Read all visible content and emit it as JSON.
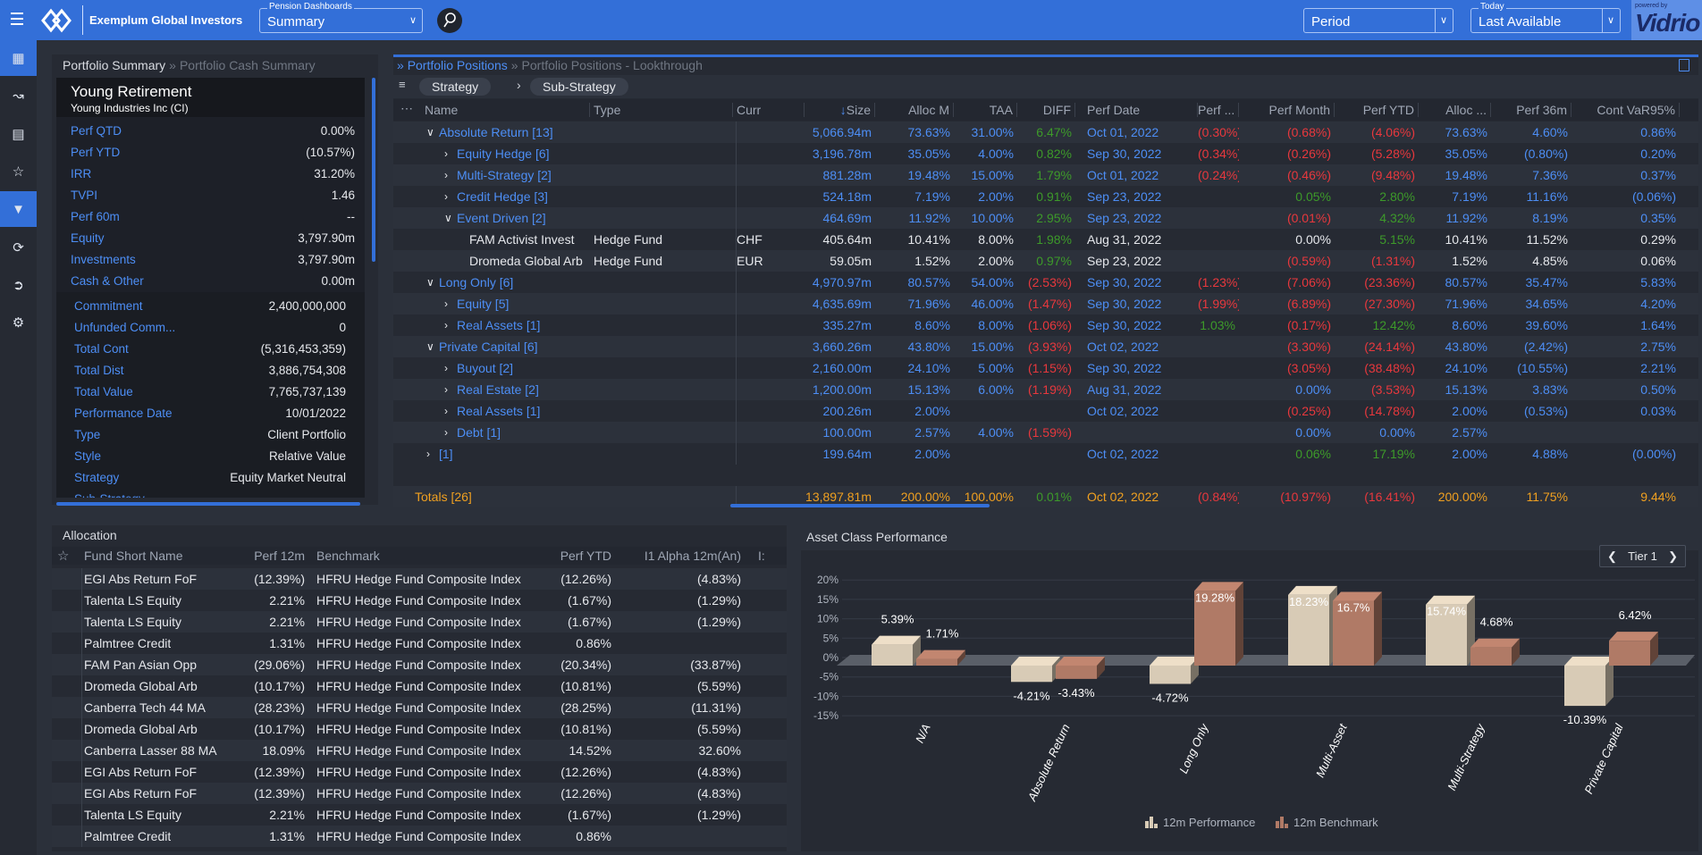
{
  "header": {
    "brand": "Exemplum Global Investors",
    "dashboard_label": "Pension Dashboards",
    "dashboard_value": "Summary",
    "period_value": "Period",
    "today_label": "Today",
    "today_value": "Last Available",
    "powered_by": "powered by",
    "vendor_logo": "Vidrio"
  },
  "sidebar": {
    "items": [
      {
        "icon": "grid-icon",
        "active": true
      },
      {
        "icon": "line-chart-icon",
        "active": false
      },
      {
        "icon": "id-card-icon",
        "active": false
      },
      {
        "icon": "star-icon",
        "active": false
      },
      {
        "icon": "filter-icon",
        "active": true
      },
      {
        "icon": "refresh-icon",
        "active": false
      },
      {
        "icon": "export-icon",
        "active": false
      },
      {
        "icon": "gear-icon",
        "active": false
      }
    ]
  },
  "summary": {
    "tab_active": "Portfolio Summary",
    "tab_inactive": "Portfolio Cash Summary",
    "title": "Young Retirement",
    "subtitle": "Young Industries Inc (CI)",
    "group1": [
      {
        "k": "Perf QTD",
        "v": "0.00%"
      },
      {
        "k": "Perf YTD",
        "v": "(10.57%)"
      },
      {
        "k": "IRR",
        "v": "31.20%"
      },
      {
        "k": "TVPI",
        "v": "1.46"
      },
      {
        "k": "Perf 60m",
        "v": "--"
      },
      {
        "k": "Equity",
        "v": "3,797.90m"
      },
      {
        "k": "Investments",
        "v": "3,797.90m"
      },
      {
        "k": "Cash & Other",
        "v": "0.00m"
      }
    ],
    "group2": [
      {
        "k": "Commitment",
        "v": "2,400,000,000"
      },
      {
        "k": "Unfunded Comm...",
        "v": "0"
      },
      {
        "k": "Total Cont",
        "v": "(5,316,453,359)"
      },
      {
        "k": "Total Dist",
        "v": "3,886,754,308"
      },
      {
        "k": "Total Value",
        "v": "7,765,737,139"
      },
      {
        "k": "Performance Date",
        "v": "10/01/2022"
      },
      {
        "k": "Type",
        "v": "Client Portfolio"
      },
      {
        "k": "Style",
        "v": "Relative Value"
      },
      {
        "k": "Strategy",
        "v": "Equity Market Neutral"
      },
      {
        "k": "Sub-Strategy",
        "v": "--"
      }
    ]
  },
  "positions": {
    "tab_active": "Portfolio Positions",
    "tab_inactive": "Portfolio Positions - Lookthrough",
    "groupings": [
      "Strategy",
      "Sub-Strategy"
    ],
    "sort_indicator": "↓",
    "columns": [
      "Name",
      "Type",
      "Curr",
      "Size",
      "Alloc M",
      "TAA",
      "DIFF",
      "Perf Date",
      "Perf ...",
      "Perf Month",
      "Perf YTD",
      "Alloc ...",
      "Perf 36m",
      "Cont VaR95%"
    ],
    "rows": [
      {
        "level": 0,
        "toggle": "down",
        "kind": "group",
        "name": "Absolute Return [13]",
        "type": "",
        "curr": "",
        "cells": [
          "5,066.94m",
          "73.63%",
          "31.00%",
          "6.47%",
          "Oct 01, 2022",
          "(0.30%)",
          "(0.68%)",
          "(4.06%)",
          "73.63%",
          "4.60%",
          "0.86%"
        ]
      },
      {
        "level": 1,
        "toggle": "right",
        "kind": "group",
        "name": "Equity Hedge [6]",
        "type": "",
        "curr": "",
        "cells": [
          "3,196.78m",
          "35.05%",
          "4.00%",
          "0.82%",
          "Sep 30, 2022",
          "(0.34%)",
          "(0.26%)",
          "(5.28%)",
          "35.05%",
          "(0.80%)",
          "0.20%"
        ]
      },
      {
        "level": 1,
        "toggle": "right",
        "kind": "group",
        "name": "Multi-Strategy [2]",
        "type": "",
        "curr": "",
        "cells": [
          "881.28m",
          "19.48%",
          "15.00%",
          "1.79%",
          "Oct 01, 2022",
          "(0.24%)",
          "(0.46%)",
          "(9.48%)",
          "19.48%",
          "7.36%",
          "0.37%"
        ]
      },
      {
        "level": 1,
        "toggle": "right",
        "kind": "group",
        "name": "Credit Hedge [3]",
        "type": "",
        "curr": "",
        "cells": [
          "524.18m",
          "7.19%",
          "2.00%",
          "0.91%",
          "Sep 23, 2022",
          "",
          "0.05%",
          "2.80%",
          "7.19%",
          "11.16%",
          "(0.06%)"
        ]
      },
      {
        "level": 1,
        "toggle": "down",
        "kind": "group",
        "name": "Event Driven [2]",
        "type": "",
        "curr": "",
        "cells": [
          "464.69m",
          "11.92%",
          "10.00%",
          "2.95%",
          "Sep 23, 2022",
          "",
          "(0.01%)",
          "4.32%",
          "11.92%",
          "8.19%",
          "0.35%"
        ]
      },
      {
        "level": 2,
        "toggle": "",
        "kind": "leaf",
        "name": "FAM Activist Invest",
        "type": "Hedge Fund",
        "curr": "CHF",
        "cells": [
          "405.64m",
          "10.41%",
          "8.00%",
          "1.98%",
          "Aug 31, 2022",
          "",
          "0.00%",
          "5.15%",
          "10.41%",
          "11.52%",
          "0.29%"
        ]
      },
      {
        "level": 2,
        "toggle": "",
        "kind": "leaf",
        "name": "Dromeda Global Arb",
        "type": "Hedge Fund",
        "curr": "EUR",
        "cells": [
          "59.05m",
          "1.52%",
          "2.00%",
          "0.97%",
          "Sep 23, 2022",
          "",
          "(0.59%)",
          "(1.31%)",
          "1.52%",
          "4.85%",
          "0.06%"
        ]
      },
      {
        "level": 0,
        "toggle": "down",
        "kind": "group",
        "name": "Long Only [6]",
        "type": "",
        "curr": "",
        "cells": [
          "4,970.97m",
          "80.57%",
          "54.00%",
          "(2.53%)",
          "Sep 30, 2022",
          "(1.23%)",
          "(7.06%)",
          "(23.36%)",
          "80.57%",
          "35.47%",
          "5.83%"
        ]
      },
      {
        "level": 1,
        "toggle": "right",
        "kind": "group",
        "name": "Equity [5]",
        "type": "",
        "curr": "",
        "cells": [
          "4,635.69m",
          "71.96%",
          "46.00%",
          "(1.47%)",
          "Sep 30, 2022",
          "(1.99%)",
          "(6.89%)",
          "(27.30%)",
          "71.96%",
          "34.65%",
          "4.20%"
        ]
      },
      {
        "level": 1,
        "toggle": "right",
        "kind": "group",
        "name": "Real Assets [1]",
        "type": "",
        "curr": "",
        "cells": [
          "335.27m",
          "8.60%",
          "8.00%",
          "(1.06%)",
          "Sep 30, 2022",
          "1.03%",
          "(0.17%)",
          "12.42%",
          "8.60%",
          "39.60%",
          "1.64%"
        ]
      },
      {
        "level": 0,
        "toggle": "down",
        "kind": "group",
        "name": "Private Capital [6]",
        "type": "",
        "curr": "",
        "cells": [
          "3,660.26m",
          "43.80%",
          "15.00%",
          "(3.93%)",
          "Oct 02, 2022",
          "",
          "(3.30%)",
          "(24.14%)",
          "43.80%",
          "(2.42%)",
          "2.75%"
        ]
      },
      {
        "level": 1,
        "toggle": "right",
        "kind": "group",
        "name": "Buyout [2]",
        "type": "",
        "curr": "",
        "cells": [
          "2,160.00m",
          "24.10%",
          "5.00%",
          "(1.15%)",
          "Sep 30, 2022",
          "",
          "(3.05%)",
          "(38.48%)",
          "24.10%",
          "(10.55%)",
          "2.21%"
        ]
      },
      {
        "level": 1,
        "toggle": "right",
        "kind": "group",
        "name": "Real Estate [2]",
        "type": "",
        "curr": "",
        "cells": [
          "1,200.00m",
          "15.13%",
          "6.00%",
          "(1.19%)",
          "Aug 31, 2022",
          "",
          "0.00%",
          "(3.53%)",
          "15.13%",
          "3.83%",
          "0.50%"
        ]
      },
      {
        "level": 1,
        "toggle": "right",
        "kind": "group",
        "name": "Real Assets [1]",
        "type": "",
        "curr": "",
        "cells": [
          "200.26m",
          "2.00%",
          "",
          "",
          "Oct 02, 2022",
          "",
          "(0.25%)",
          "(14.78%)",
          "2.00%",
          "(0.53%)",
          "0.03%"
        ]
      },
      {
        "level": 1,
        "toggle": "right",
        "kind": "group",
        "name": "Debt [1]",
        "type": "",
        "curr": "",
        "cells": [
          "100.00m",
          "2.57%",
          "4.00%",
          "(1.59%)",
          "",
          "",
          "0.00%",
          "0.00%",
          "2.57%",
          "",
          ""
        ]
      },
      {
        "level": 0,
        "toggle": "right",
        "kind": "group",
        "name": "[1]",
        "type": "",
        "curr": "",
        "cells": [
          "199.64m",
          "2.00%",
          "",
          "",
          "Oct 02, 2022",
          "",
          "0.06%",
          "17.19%",
          "2.00%",
          "4.88%",
          "(0.00%)"
        ]
      }
    ],
    "totals": {
      "name": "Totals [26]",
      "cells": [
        "13,897.81m",
        "200.00%",
        "100.00%",
        "0.01%",
        "Oct 02, 2022",
        "(0.84%)",
        "(10.97%)",
        "(16.41%)",
        "200.00%",
        "11.75%",
        "9.44%"
      ]
    }
  },
  "allocation": {
    "title": "Allocation",
    "columns": [
      "Fund Short Name",
      "Perf 12m",
      "Benchmark",
      "Perf YTD",
      "I1 Alpha 12m(An)",
      "I:"
    ],
    "rows": [
      [
        "EGI Abs Return FoF",
        "(12.39%)",
        "HFRU Hedge Fund Composite Index",
        "(12.26%)",
        "(4.83%)"
      ],
      [
        "Talenta LS Equity",
        "2.21%",
        "HFRU Hedge Fund Composite Index",
        "(1.67%)",
        "(1.29%)"
      ],
      [
        "Talenta LS Equity",
        "2.21%",
        "HFRU Hedge Fund Composite Index",
        "(1.67%)",
        "(1.29%)"
      ],
      [
        "Palmtree Credit",
        "1.31%",
        "HFRU Hedge Fund Composite Index",
        "0.86%",
        ""
      ],
      [
        "FAM Pan Asian Opp",
        "(29.06%)",
        "HFRU Hedge Fund Composite Index",
        "(20.34%)",
        "(33.87%)"
      ],
      [
        "Dromeda Global Arb",
        "(10.17%)",
        "HFRU Hedge Fund Composite Index",
        "(10.81%)",
        "(5.59%)"
      ],
      [
        "Canberra Tech 44 MA",
        "(28.23%)",
        "HFRU Hedge Fund Composite Index",
        "(28.25%)",
        "(11.31%)"
      ],
      [
        "Dromeda Global Arb",
        "(10.17%)",
        "HFRU Hedge Fund Composite Index",
        "(10.81%)",
        "(5.59%)"
      ],
      [
        "Canberra Lasser 88 MA",
        "18.09%",
        "HFRU Hedge Fund Composite Index",
        "14.52%",
        "32.60%"
      ],
      [
        "EGI Abs Return FoF",
        "(12.39%)",
        "HFRU Hedge Fund Composite Index",
        "(12.26%)",
        "(4.83%)"
      ],
      [
        "EGI Abs Return FoF",
        "(12.39%)",
        "HFRU Hedge Fund Composite Index",
        "(12.26%)",
        "(4.83%)"
      ],
      [
        "Talenta LS Equity",
        "2.21%",
        "HFRU Hedge Fund Composite Index",
        "(1.67%)",
        "(1.29%)"
      ],
      [
        "Palmtree Credit",
        "1.31%",
        "HFRU Hedge Fund Composite Index",
        "0.86%",
        ""
      ]
    ]
  },
  "chart_panel": {
    "title": "Asset Class Performance",
    "tier_label": "Tier 1"
  },
  "chart_data": {
    "type": "bar",
    "title": "",
    "categories": [
      "N/A",
      "Absolute Return",
      "Long Only",
      "Multi-Asset",
      "Multi-Strategy",
      "Private Capital"
    ],
    "series": [
      {
        "name": "12m Performance",
        "values": [
          5.39,
          -4.21,
          -4.72,
          18.23,
          15.74,
          -10.39
        ],
        "labels": [
          "5.39%",
          "-4.21%",
          "-4.72%",
          "18.23%",
          "15.74%",
          "-10.39%"
        ],
        "color": "#d8cbb6"
      },
      {
        "name": "12m Benchmark",
        "values": [
          1.71,
          -3.43,
          19.28,
          16.7,
          4.68,
          6.42
        ],
        "labels": [
          "1.71%",
          "-3.43%",
          "19.28%",
          "16.7%",
          "4.68%",
          "6.42%"
        ],
        "color": "#b07a66"
      }
    ],
    "yticks": [
      "20%",
      "15%",
      "10%",
      "5%",
      "0%",
      "-5%",
      "-10%",
      "-15%"
    ],
    "ylim": [
      -15,
      20
    ],
    "grid": true,
    "legend": "bottom",
    "style": "3d"
  },
  "colors": {
    "accent": "#336fd8",
    "positive": "#3d9a2a",
    "negative": "#e8383d",
    "link": "#4d8ef5",
    "totals": "#f0a020"
  }
}
